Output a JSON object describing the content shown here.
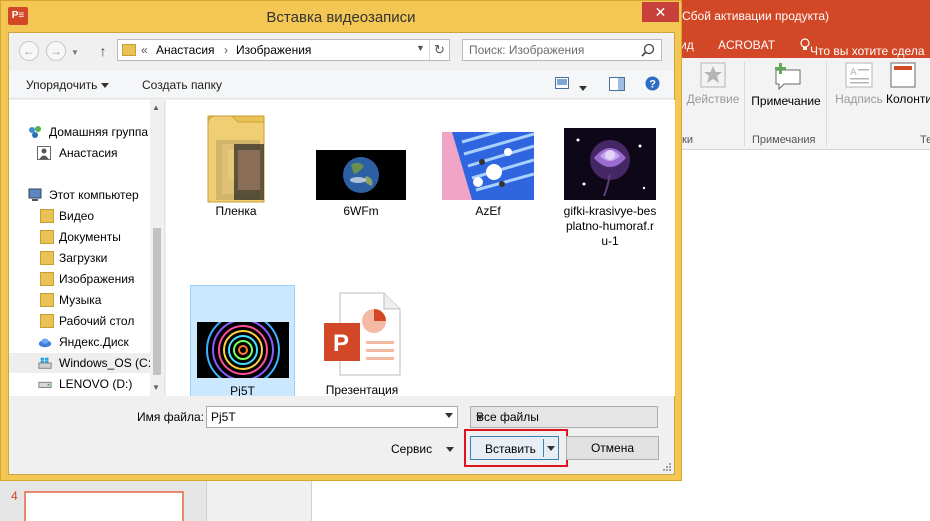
{
  "ppt": {
    "title_fragment": "Сбой активации продукта)",
    "tabs": [
      "ид",
      "ACROBAT",
      "Что вы хотите сдела"
    ],
    "ribbon": {
      "action_label": "Действие",
      "comment_label": "Примечание",
      "caption_label": "Надпись",
      "column_label": "Колонти",
      "group_left": "ки",
      "group_comments": "Примечания",
      "group_right": "Те"
    },
    "slide_number": "4"
  },
  "dialog": {
    "app_icon": "P≡",
    "title": "Вставка видеозаписи",
    "close": "✕",
    "address": {
      "prefix": "«",
      "path": [
        "Анастасия",
        "Изображения"
      ]
    },
    "search_placeholder": "Поиск: Изображения",
    "toolbar": {
      "organize": "Упорядочить",
      "new_folder": "Создать папку"
    },
    "nav": {
      "homegroup": "Домашняя группа",
      "user": "Анастасия",
      "computer": "Этот компьютер",
      "folders": [
        "Видео",
        "Документы",
        "Загрузки",
        "Изображения",
        "Музыка",
        "Рабочий стол"
      ],
      "yandex": "Яндекс.Диск",
      "drive_c": "Windows_OS (C:)",
      "drive_d": "LENOVO (D:)"
    },
    "files": [
      {
        "name": "Пленка",
        "type": "folder"
      },
      {
        "name": "6WFm",
        "type": "video"
      },
      {
        "name": "AzEf",
        "type": "video"
      },
      {
        "name": "gifki-krasivye-bes platno-humoraf.r u-1",
        "lines": [
          "gifki-krasivye-bes",
          "platno-humoraf.r",
          "u-1"
        ],
        "type": "video"
      },
      {
        "name": "Pj5T",
        "type": "video",
        "selected": true
      },
      {
        "name": "Презентация",
        "type": "pptx"
      }
    ],
    "filename_label": "Имя файла:",
    "filename_value": "Pj5T",
    "filter_value": "Все файлы",
    "service_label": "Сервис",
    "insert_label": "Вставить",
    "cancel_label": "Отмена"
  },
  "colors": {
    "ppt_accent": "#d24726",
    "dialog_frame": "#f4c754",
    "selection": "#cce8ff",
    "highlight_box": "#e0141e"
  }
}
